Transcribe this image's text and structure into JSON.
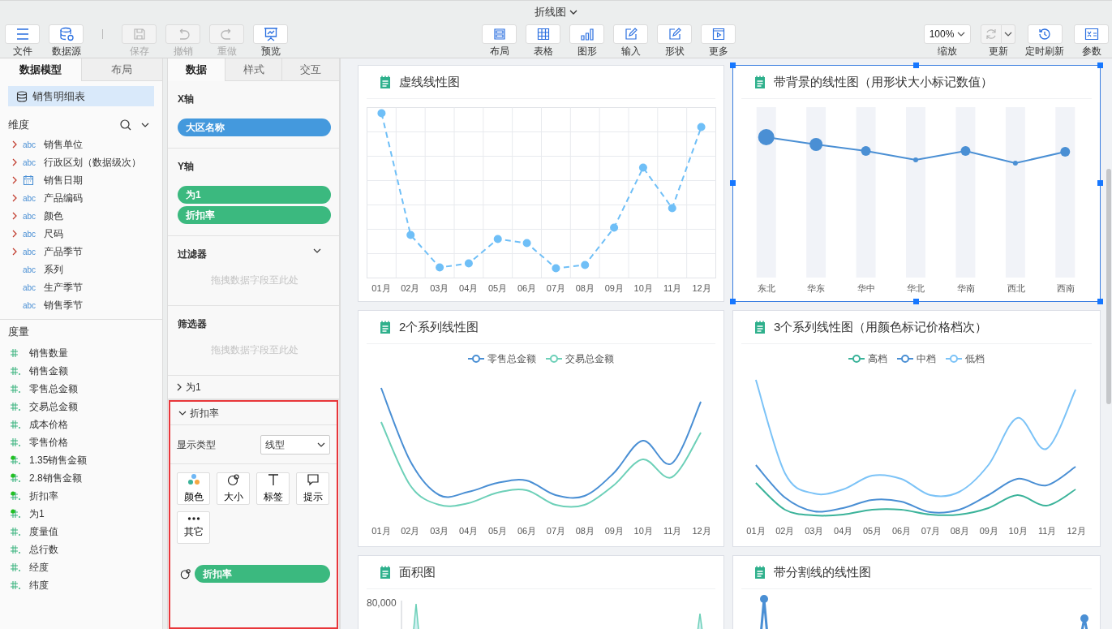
{
  "window": {
    "title": "折线图"
  },
  "toolbar": {
    "left": [
      {
        "label": "文件",
        "kind": "file",
        "disabled": false
      },
      {
        "label": "数据源",
        "kind": "datasource",
        "disabled": false
      },
      {
        "label": "保存",
        "kind": "save",
        "disabled": true
      },
      {
        "label": "撤销",
        "kind": "undo",
        "disabled": true
      },
      {
        "label": "重做",
        "kind": "redo",
        "disabled": true
      },
      {
        "label": "预览",
        "kind": "preview",
        "disabled": false
      }
    ],
    "center": [
      {
        "label": "布局",
        "kind": "layout",
        "disabled": false
      },
      {
        "label": "表格",
        "kind": "table",
        "disabled": false
      },
      {
        "label": "图形",
        "kind": "chart",
        "disabled": false
      },
      {
        "label": "输入",
        "kind": "input",
        "disabled": false
      },
      {
        "label": "形状",
        "kind": "shape",
        "disabled": false
      },
      {
        "label": "更多",
        "kind": "more",
        "disabled": false
      }
    ],
    "zoom": {
      "value": "100%",
      "label": "缩放"
    },
    "refresh": {
      "label": "更新",
      "disabled": true
    },
    "right": [
      {
        "label": "定时刷新",
        "kind": "timer",
        "disabled": false
      },
      {
        "label": "参数",
        "kind": "params",
        "disabled": false
      }
    ]
  },
  "data_panel": {
    "tabs": [
      {
        "label": "数据模型",
        "selected": true
      },
      {
        "label": "布局",
        "selected": false
      }
    ],
    "dataset": {
      "name": "销售明细表",
      "selected": true
    },
    "dimensions": {
      "title": "维度",
      "items": [
        {
          "name": "销售单位",
          "kind": "text",
          "type_label": "abc",
          "expandable": true
        },
        {
          "name": "行政区划（数据级次）",
          "kind": "text",
          "type_label": "abc",
          "expandable": true
        },
        {
          "name": "销售日期",
          "kind": "date",
          "expandable": true
        },
        {
          "name": "产品编码",
          "kind": "text",
          "type_label": "abc",
          "expandable": true
        },
        {
          "name": "颜色",
          "kind": "text",
          "type_label": "abc",
          "expandable": true
        },
        {
          "name": "尺码",
          "kind": "text",
          "type_label": "abc",
          "expandable": true
        },
        {
          "name": "产品季节",
          "kind": "text",
          "type_label": "abc",
          "expandable": true
        },
        {
          "name": "系列",
          "kind": "text",
          "type_label": "abc",
          "expandable": false
        },
        {
          "name": "生产季节",
          "kind": "text",
          "type_label": "abc",
          "expandable": false
        },
        {
          "name": "销售季节",
          "kind": "text",
          "type_label": "abc",
          "expandable": false
        }
      ]
    },
    "measures": {
      "title": "度量",
      "items": [
        {
          "name": "销售数量",
          "kind": "integer",
          "in_use": false
        },
        {
          "name": "销售金额",
          "kind": "decimal",
          "in_use": false
        },
        {
          "name": "零售总金额",
          "kind": "decimal",
          "in_use": false
        },
        {
          "name": "交易总金额",
          "kind": "decimal",
          "in_use": false
        },
        {
          "name": "成本价格",
          "kind": "decimal",
          "in_use": false
        },
        {
          "name": "零售价格",
          "kind": "decimal",
          "in_use": false
        },
        {
          "name": "1.35销售金额",
          "kind": "decimal",
          "in_use": true
        },
        {
          "name": "2.8销售金额",
          "kind": "decimal",
          "in_use": true
        },
        {
          "name": "折扣率",
          "kind": "decimal",
          "in_use": true
        },
        {
          "name": "为1",
          "kind": "decimal",
          "in_use": true
        },
        {
          "name": "度量值",
          "kind": "decimal",
          "in_use": false
        },
        {
          "name": "总行数",
          "kind": "decimal",
          "in_use": false
        },
        {
          "name": "经度",
          "kind": "decimal",
          "in_use": false
        },
        {
          "name": "纬度",
          "kind": "decimal",
          "in_use": false
        }
      ]
    }
  },
  "field_panel": {
    "tabs": [
      {
        "label": "数据",
        "selected": true
      },
      {
        "label": "样式",
        "selected": false
      },
      {
        "label": "交互",
        "selected": false
      }
    ],
    "x_axis": {
      "title": "X轴",
      "fields": [
        {
          "name": "大区名称",
          "kind": "dimension"
        }
      ]
    },
    "y_axis": {
      "title": "Y轴",
      "fields": [
        {
          "name": "为1",
          "kind": "measure"
        },
        {
          "name": "折扣率",
          "kind": "measure"
        }
      ]
    },
    "filter": {
      "title": "过滤器",
      "placeholder": "拖拽数据字段至此处"
    },
    "screener": {
      "title": "筛选器",
      "placeholder": "拖拽数据字段至此处"
    },
    "series": [
      {
        "name": "为1",
        "expanded": false,
        "highlighted": false
      },
      {
        "name": "折扣率",
        "expanded": true,
        "highlighted": true,
        "display_type": {
          "label": "显示类型",
          "value": "线型"
        },
        "marks": [
          {
            "label": "颜色",
            "kind": "color"
          },
          {
            "label": "大小",
            "kind": "size"
          },
          {
            "label": "标签",
            "kind": "label"
          },
          {
            "label": "提示",
            "kind": "tooltip"
          },
          {
            "label": "其它",
            "kind": "other"
          }
        ],
        "bindings": [
          {
            "name": "折扣率",
            "kind": "size"
          }
        ]
      }
    ]
  },
  "charts": [
    {
      "title": "虚线线性图",
      "kind": "dashed",
      "selected": false,
      "x_labels": [
        "01月",
        "02月",
        "03月",
        "04月",
        "05月",
        "06月",
        "07月",
        "08月",
        "09月",
        "10月",
        "11月",
        "12月"
      ]
    },
    {
      "title": "带背景的线性图（用形状大小标记数值）",
      "kind": "bubble",
      "selected": true,
      "x_labels": [
        "东北",
        "华东",
        "华中",
        "华北",
        "华南",
        "西北",
        "西南"
      ]
    },
    {
      "title": "2个系列线性图",
      "kind": "two_series",
      "selected": false,
      "legend": [
        {
          "name": "零售总金额",
          "color": "#4a8fd4"
        },
        {
          "name": "交易总金额",
          "color": "#6dd0b8"
        }
      ],
      "x_labels": [
        "01月",
        "02月",
        "03月",
        "04月",
        "05月",
        "06月",
        "07月",
        "08月",
        "09月",
        "10月",
        "11月",
        "12月"
      ]
    },
    {
      "title": "3个系列线性图（用颜色标记价格档次）",
      "kind": "three_series",
      "selected": false,
      "legend": [
        {
          "name": "高档",
          "color": "#3bb39a"
        },
        {
          "name": "中档",
          "color": "#4a8fd4"
        },
        {
          "name": "低档",
          "color": "#7cc3f7"
        }
      ],
      "x_labels": [
        "01月",
        "02月",
        "03月",
        "04月",
        "05月",
        "06月",
        "07月",
        "08月",
        "09月",
        "10月",
        "11月",
        "12月"
      ]
    },
    {
      "title": "面积图",
      "kind": "area",
      "selected": false,
      "y_top_label": "80,000"
    },
    {
      "title": "带分割线的线性图",
      "kind": "split",
      "selected": false
    }
  ]
}
